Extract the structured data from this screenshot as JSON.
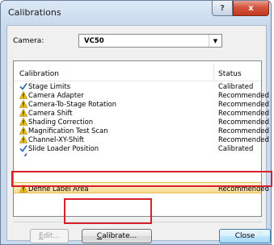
{
  "window": {
    "title": "Calibrations",
    "help_glyph": "?",
    "close_glyph": "x"
  },
  "camera": {
    "label": "Camera:",
    "value": "VC50"
  },
  "list": {
    "headers": {
      "calibration": "Calibration",
      "status": "Status"
    },
    "rows": [
      {
        "name": "Stage Limits",
        "status": "Calibrated",
        "icon": "check-icon"
      },
      {
        "name": "Camera Adapter",
        "status": "Recommended",
        "icon": "warning-icon"
      },
      {
        "name": "Camera-To-Stage Rotation",
        "status": "Recommended",
        "icon": "warning-icon"
      },
      {
        "name": "Camera Shift",
        "status": "Recommended",
        "icon": "warning-icon"
      },
      {
        "name": "Shading Correction",
        "status": "Recommended",
        "icon": "warning-icon"
      },
      {
        "name": "Magnification Test Scan",
        "status": "Recommended",
        "icon": "warning-icon"
      },
      {
        "name": "Channel-XY-Shift",
        "status": "Recommended",
        "icon": "warning-icon"
      },
      {
        "name": "Slide Loader Position",
        "status": "Calibrated",
        "icon": "check-icon"
      },
      {
        "name": "Define Label Area",
        "status": "Recommended",
        "icon": "warning-icon",
        "selected": true
      }
    ]
  },
  "buttons": {
    "edit": "Edit...",
    "calibrate": "Calibrate...",
    "close": "Close"
  },
  "colors": {
    "highlight": "#d8202a",
    "selection": "#f6d98f",
    "check": "#2b63b5",
    "warning": "#f2c20c"
  }
}
